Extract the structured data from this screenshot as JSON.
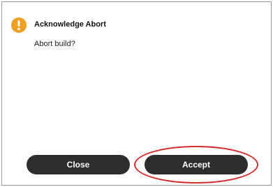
{
  "dialog": {
    "title": "Acknowledge Abort",
    "message": "Abort build?",
    "icon": "warning-icon",
    "close_label": "Close",
    "accept_label": "Accept"
  },
  "colors": {
    "warning": "#f0a020",
    "button_bg": "#2d2d2d",
    "button_text": "#ffffff",
    "highlight": "#d42a2a"
  }
}
